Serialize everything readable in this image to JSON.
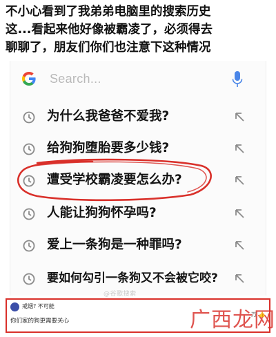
{
  "caption": {
    "line1": "不小心看到了我弟弟电脑里的搜索历史",
    "line2": "这...看起来他好像被霸凌了，必须得去",
    "line3": "聊聊了，朋友们你们也注意下这种情况"
  },
  "search": {
    "placeholder": "Search...",
    "logo_icon": "google-g-icon",
    "mic_icon": "microphone-icon"
  },
  "suggestions": [
    {
      "label": "为什么我爸爸不爱我?",
      "icon": "history-clock-icon",
      "action_icon": "fill-query-arrow-icon"
    },
    {
      "label": "给狗狗堕胎要多少钱?",
      "icon": "history-clock-icon",
      "action_icon": "fill-query-arrow-icon"
    },
    {
      "label": "遭受学校霸凌要怎么办?",
      "icon": "history-clock-icon",
      "action_icon": "fill-query-arrow-icon",
      "highlighted": true
    },
    {
      "label": "人能让狗狗怀孕吗?",
      "icon": "history-clock-icon",
      "action_icon": "fill-query-arrow-icon"
    },
    {
      "label": "爱上一条狗是一种罪吗?",
      "icon": "history-clock-icon",
      "action_icon": "fill-query-arrow-icon"
    },
    {
      "label": "要如何勾引一条狗又不会被它咬?",
      "icon": "history-clock-icon",
      "action_icon": "fill-query-arrow-icon"
    }
  ],
  "card_watermark": "@谷歌搜索",
  "ad": {
    "title": "戒烟? 不可能",
    "subtitle": "你们家的狗更需要关心",
    "watermark": "广西龙网",
    "like": "万 👍"
  },
  "colors": {
    "accent_red": "#d9302a",
    "text_dark": "#141414",
    "placeholder_gray": "#b9b9b9",
    "icon_gray": "#8a8a8a"
  }
}
